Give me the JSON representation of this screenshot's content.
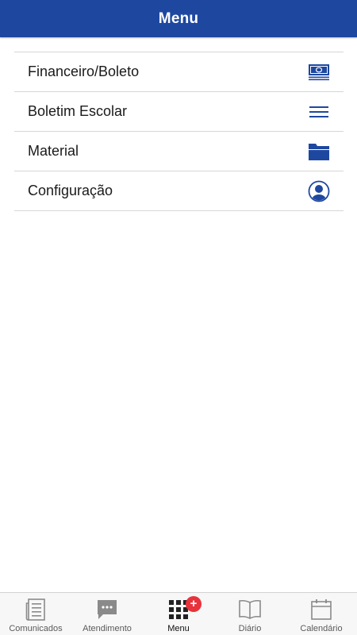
{
  "header": {
    "title": "Menu"
  },
  "menu": {
    "items": [
      {
        "label": "Financeiro/Boleto",
        "icon": "money-icon"
      },
      {
        "label": "Boletim Escolar",
        "icon": "list-icon"
      },
      {
        "label": "Material",
        "icon": "folder-icon"
      },
      {
        "label": "Configuração",
        "icon": "user-icon"
      }
    ]
  },
  "tabbar": {
    "tabs": [
      {
        "label": "Comunicados",
        "icon": "newspaper-icon"
      },
      {
        "label": "Atendimento",
        "icon": "chat-icon"
      },
      {
        "label": "Menu",
        "icon": "grid-icon",
        "active": true,
        "badge": "+"
      },
      {
        "label": "Diário",
        "icon": "book-icon"
      },
      {
        "label": "Calendário",
        "icon": "calendar-icon"
      }
    ]
  },
  "colors": {
    "brand": "#1e48a0",
    "icon_blue": "#1e48a0",
    "badge": "#e8323c",
    "tab_icon_inactive": "#8a8a8a"
  }
}
